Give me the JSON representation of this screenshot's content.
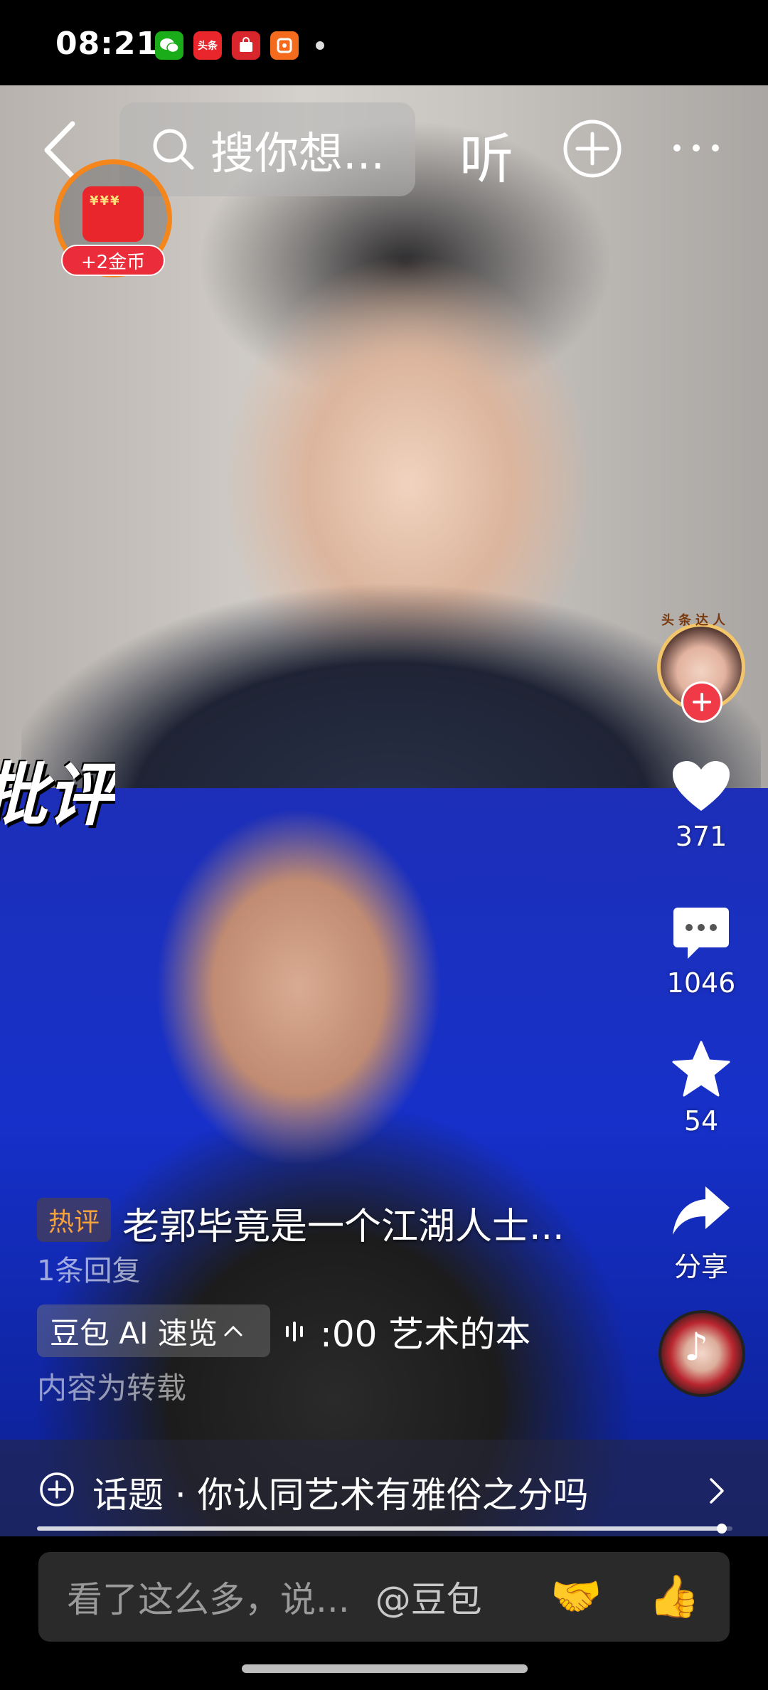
{
  "status_bar": {
    "time": "08:21",
    "apps": [
      {
        "icon": "wechat-icon",
        "color": "#1aad19",
        "label": ""
      },
      {
        "icon": "toutiao-icon",
        "color": "#e8262c",
        "label": "头条"
      },
      {
        "icon": "shopping-icon",
        "color": "#d9262c",
        "label": ""
      },
      {
        "icon": "taobao-icon",
        "color": "#f46b1d",
        "label": ""
      }
    ]
  },
  "top_bar": {
    "search_placeholder": "搜你想...",
    "listen_label": "听"
  },
  "reward": {
    "badge": "+2金币",
    "coin_text": "¥¥¥"
  },
  "author": {
    "tag": "头条达人"
  },
  "video": {
    "banner_text": "批评"
  },
  "actions": {
    "like_count": "371",
    "comment_count": "1046",
    "favorite_count": "54",
    "share_label": "分享"
  },
  "comment": {
    "hot_tag": "热评",
    "hot_text": "老郭毕竟是一个江湖人士...",
    "reply_count": "1条回复"
  },
  "ai_summary": {
    "chip_label": "豆包 AI 速览",
    "scroll_text": ":00 艺术的本",
    "repost_note": "内容为转载"
  },
  "topic": {
    "text": "话题 · 你认同艺术有雅俗之分吗"
  },
  "progress": {
    "fraction": 0.985
  },
  "input_bar": {
    "placeholder": "看了这么多，说...",
    "mention": "@豆包",
    "emoji_handshake": "🤝",
    "emoji_thumbs": "👍"
  },
  "colors": {
    "accent_red": "#f03a47",
    "hot_orange": "#f5a23d",
    "reward_ring": "#f5861c"
  }
}
